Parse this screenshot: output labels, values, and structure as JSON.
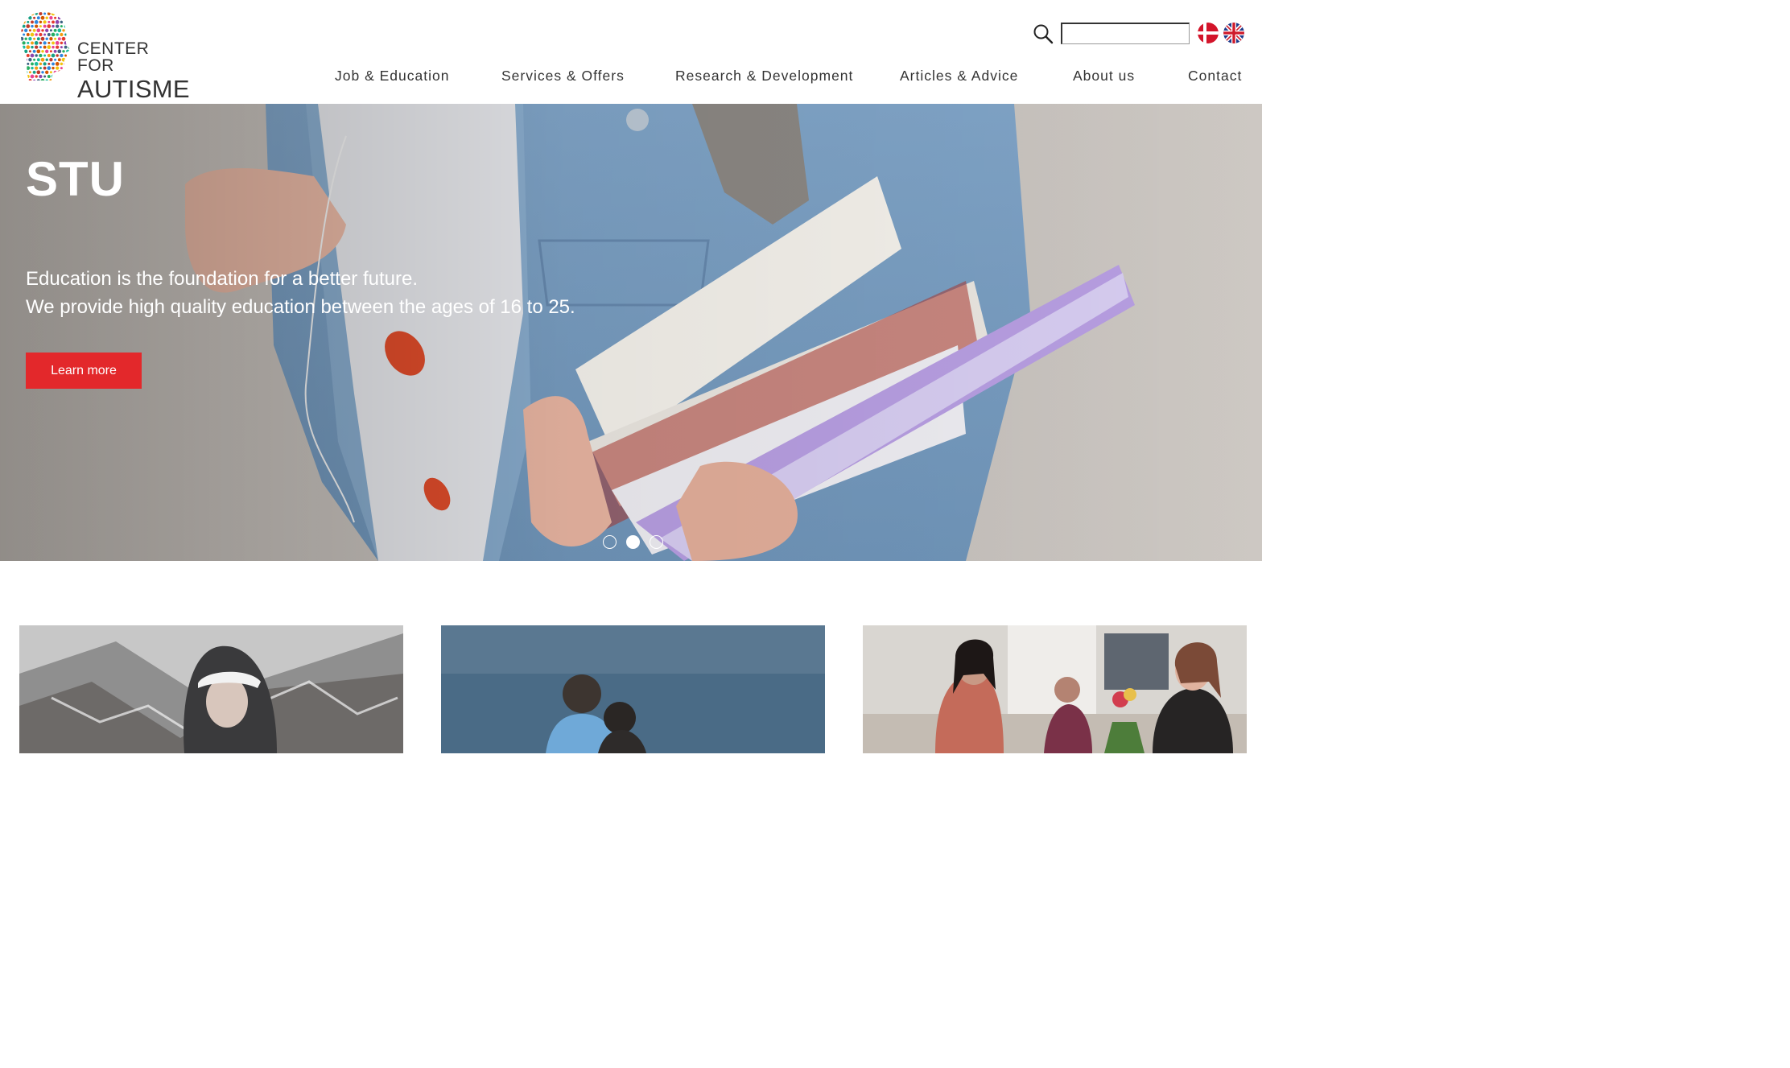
{
  "header": {
    "logo": {
      "line1": "CENTER FOR",
      "line2": "AUTISME"
    },
    "search": {
      "icon": "search-icon",
      "value": "",
      "placeholder": ""
    },
    "languages": [
      {
        "code": "da",
        "icon": "danish-flag-icon"
      },
      {
        "code": "en",
        "icon": "uk-flag-icon"
      }
    ],
    "nav": [
      {
        "label": "Job & Education"
      },
      {
        "label": "Services & Offers"
      },
      {
        "label": "Research & Development"
      },
      {
        "label": "Articles & Advice"
      },
      {
        "label": "About us"
      },
      {
        "label": "Contact"
      }
    ]
  },
  "hero": {
    "title": "STU",
    "text_line1": "Education is the foundation for a better future.",
    "text_line2": "We provide high quality education between the ages of 16 to 25.",
    "button_label": "Learn more",
    "slides_count": 3,
    "active_slide": 2
  },
  "colors": {
    "accent": "#e3282b",
    "text": "#333333",
    "background": "#ffffff"
  }
}
